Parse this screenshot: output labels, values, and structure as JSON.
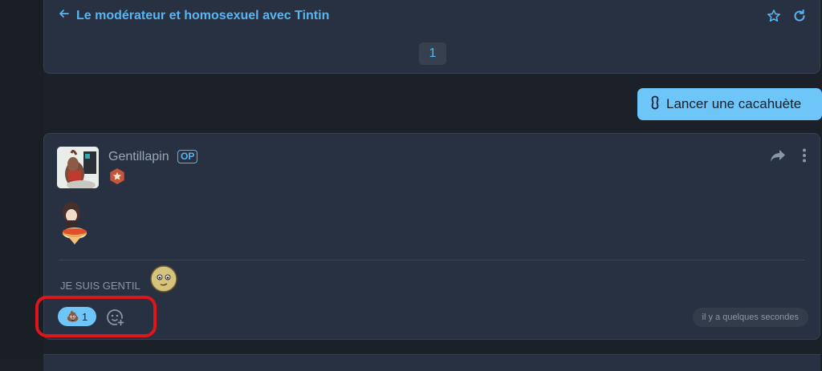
{
  "topic": {
    "back_icon": "arrow-left-icon",
    "title": "Le modérateur et homosexuel avec Tintin",
    "actions": [
      "star-icon",
      "refresh-icon"
    ],
    "current_page": "1"
  },
  "launch_button": {
    "icon": "peanut-icon",
    "label": "Lancer une cacahuète"
  },
  "post": {
    "username": "Gentillapin",
    "op_badge": "OP",
    "rank_icon": "star-badge-icon",
    "actions": [
      "share-icon",
      "more-vertical-icon"
    ],
    "text": "JE SUIS GENTIL",
    "reaction": {
      "emoji": "💩",
      "count": "1"
    },
    "add_reaction_icon": "add-reaction-icon",
    "timestamp": "il y a quelques secondes"
  },
  "colors": {
    "background": "#1c2028",
    "card": "#283142",
    "accent": "#58b4f0",
    "button": "#6ec6f8",
    "highlight": "#e0141b"
  }
}
